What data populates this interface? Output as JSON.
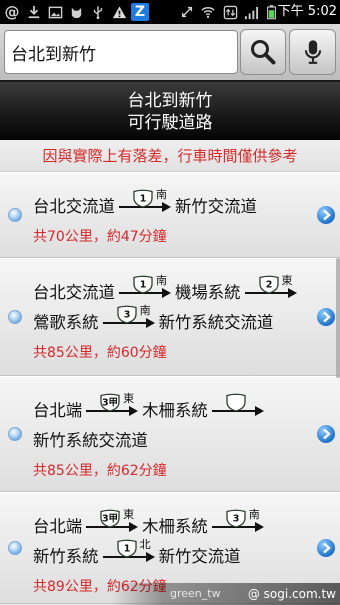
{
  "status_bar": {
    "left_icons": [
      {
        "name": "at-icon",
        "glyph": "@"
      },
      {
        "name": "download-icon"
      },
      {
        "name": "image-icon"
      },
      {
        "name": "cat-icon"
      },
      {
        "name": "usb-icon"
      },
      {
        "name": "warning-icon"
      },
      {
        "name": "z-app-icon",
        "glyph": "Z"
      }
    ],
    "right_icons": [
      "sync-icon",
      "wifi-icon",
      "data-icon",
      "signal-icon",
      "battery-icon"
    ],
    "time": "下午 5:02"
  },
  "search": {
    "value": "台北到新竹",
    "search_icon": "magnifier-icon",
    "voice_icon": "microphone-icon"
  },
  "header": {
    "title": "台北到新竹",
    "subtitle": "可行駛道路"
  },
  "notice": "因與實際上有落差，行車時間僅供參考",
  "routes": [
    {
      "rows": [
        [
          {
            "place": "台北交流道"
          },
          {
            "road": "1",
            "direction": "南"
          },
          {
            "place": "新竹交流道"
          }
        ]
      ],
      "summary": "共70公里，約47分鐘"
    },
    {
      "rows": [
        [
          {
            "place": "台北交流道"
          },
          {
            "road": "1",
            "direction": "南"
          },
          {
            "place": "機場系統"
          },
          {
            "road": "2",
            "direction": "東"
          }
        ],
        [
          {
            "place": "鶯歌系統"
          },
          {
            "road": "3",
            "direction": "南"
          },
          {
            "place": "新竹系統交流道"
          }
        ]
      ],
      "summary": "共85公里，約60分鐘"
    },
    {
      "rows": [
        [
          {
            "place": "台北端"
          },
          {
            "road": "3甲",
            "direction": "東"
          },
          {
            "place": "木柵系統"
          },
          {
            "road": null
          }
        ],
        [
          {
            "place": "新竹系統交流道"
          }
        ]
      ],
      "summary": "共85公里，約62分鐘"
    },
    {
      "rows": [
        [
          {
            "place": "台北端"
          },
          {
            "road": "3甲",
            "direction": "東"
          },
          {
            "place": "木柵系統"
          },
          {
            "road": "3",
            "direction": "南"
          }
        ],
        [
          {
            "place": "新竹系統"
          },
          {
            "road": "1",
            "direction": "北"
          },
          {
            "place": "新竹交流道"
          }
        ]
      ],
      "summary": "共89公里，約62分鐘"
    }
  ],
  "watermark": {
    "author": "green_tw",
    "site": "@ sogi.com.tw"
  },
  "colors": {
    "status_bar_bg": "#000000",
    "header_bg": "#1a1a1a",
    "header_text": "#ffffff",
    "notice_text": "#d42a2a",
    "summary_text": "#d7282c",
    "link_blue": "#1f72c9",
    "bullet_blue": "#3f86cf",
    "z_icon_blue": "#1e7be0"
  }
}
